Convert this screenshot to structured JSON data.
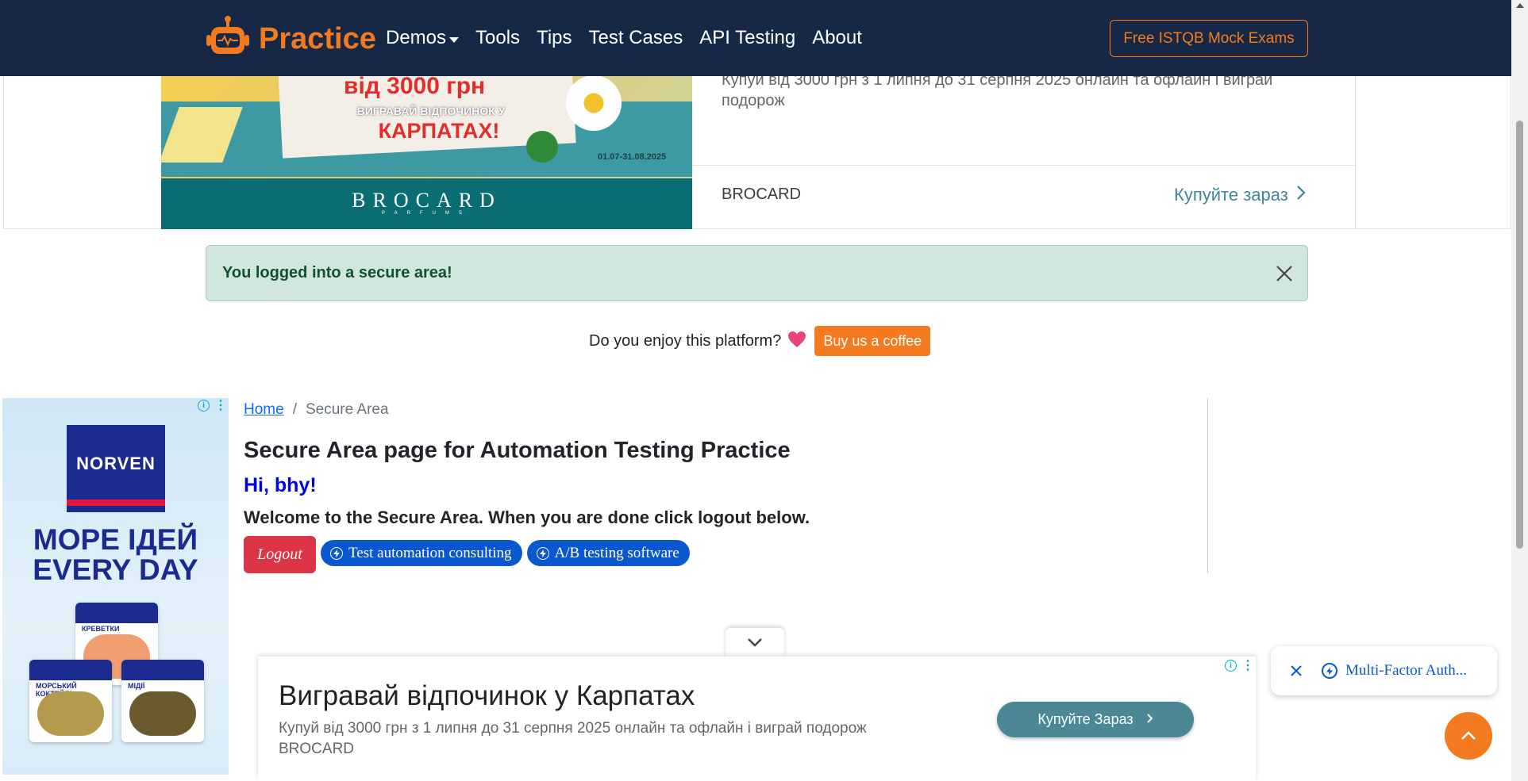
{
  "top_ad": {
    "promo_amount": "від 3000 грн",
    "promo_line": "ВИГРАВАЙ ВІДПОЧИНОК У",
    "promo_place": "КАРПАТАХ!",
    "promo_date": "01.07-31.08.2025",
    "image_brand": "BROCARD",
    "image_brand_sub": "PARFUMS",
    "description": "Купуй від 3000 грн з 1 липня до 31 серпня 2025 онлайн та офлайн і виграй подорож",
    "brand": "BROCARD",
    "cta": "Купуйте зараз"
  },
  "navbar": {
    "logo_text": "Practice",
    "links": [
      {
        "label": "Demos",
        "has_dropdown": true
      },
      {
        "label": "Tools"
      },
      {
        "label": "Tips"
      },
      {
        "label": "Test Cases"
      },
      {
        "label": "API Testing"
      },
      {
        "label": "About"
      }
    ],
    "cta": "Free ISTQB Mock Exams"
  },
  "alert": {
    "message": "You logged into a secure area!"
  },
  "coffee": {
    "question": "Do you enjoy this platform?",
    "button": "Buy us a coffee"
  },
  "left_ad": {
    "brand": "NORVEN",
    "tagline": "МОРЕ ІДЕЙ EVERY DAY",
    "packs": [
      "КРЕВЕТКИ",
      "МОРСЬКИЙ КОКТЕЙЛЬ",
      "МІДІЇ"
    ]
  },
  "breadcrumb": {
    "home": "Home",
    "separator": "/",
    "current": "Secure Area"
  },
  "main": {
    "title": "Secure Area page for Automation Testing Practice",
    "greeting": "Hi, bhy!",
    "welcome": "Welcome to the Secure Area. When you are done click logout below.",
    "logout": "Logout",
    "pills": [
      "Test automation consulting",
      "A/B testing software"
    ]
  },
  "bottom_ad": {
    "title": "Вигравай відпочинок у Карпатах",
    "description": "Купуй від 3000 грн з 1 липня до 31 серпня 2025 онлайн та офлайн і виграй подорож",
    "brand": "BROCARD",
    "cta": "Купуйте Зараз"
  },
  "floating_chip": {
    "text": "Multi-Factor Auth..."
  },
  "colors": {
    "navbar_bg": "#162846",
    "brand_orange": "#f37a1f",
    "alert_bg": "#d1e7dd",
    "alert_text": "#0f5132",
    "logout_red": "#dc3545",
    "pill_blue": "#0b57d0",
    "greeting_blue": "#0000ee",
    "ad_teal": "#4b8794"
  },
  "icons": {
    "logo": "robot-icon",
    "alert_close": "close-icon",
    "heart": "heart-icon",
    "pill": "lightning-circle-icon",
    "ad_info": "info-icon",
    "ad_menu": "kebab-icon",
    "collapse": "chevron-down-icon",
    "chip_close": "close-icon",
    "to_top": "chevron-up-icon"
  }
}
